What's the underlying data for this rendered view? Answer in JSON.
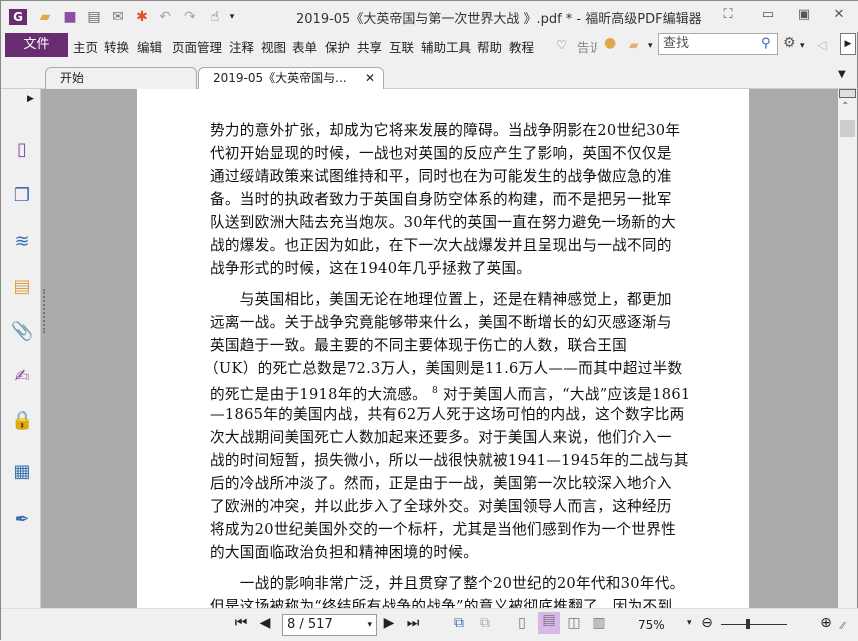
{
  "window": {
    "title": "2019-05《大英帝国与第一次世界大战 》.pdf * - 福昕高级PDF编辑器"
  },
  "menu": {
    "file": "文件",
    "items": [
      "主页",
      "转换",
      "编辑",
      "页面管理",
      "注释",
      "视图",
      "表单",
      "保护",
      "共享",
      "互联",
      "辅助工具",
      "帮助",
      "教程"
    ],
    "tell_me": "告诉",
    "search_placeholder": "查找"
  },
  "tabs": [
    {
      "label": "开始"
    },
    {
      "label": "2019-05《大英帝国与..."
    }
  ],
  "document": {
    "paragraphs": [
      [
        "势力的意外扩张，却成为它将来发展的障碍。当战争阴影在20世纪30年",
        "代初开始显现的时候，一战也对英国的反应产生了影响，英国不仅仅是",
        "通过绥靖政策来试图维持和平，同时也在为可能发生的战争做应急的准",
        "备。当时的执政者致力于英国自身防空体系的构建，而不是把另一批军",
        "队送到欧洲大陆去充当炮灰。30年代的英国一直在努力避免一场新的大",
        "战的爆发。也正因为如此，在下一次大战爆发并且呈现出与一战不同的",
        "战争形式的时候，这在1940年几乎拯救了英国。"
      ],
      [
        "　　与英国相比，美国无论在地理位置上，还是在精神感觉上，都更加",
        "远离一战。关于战争究竟能够带来什么，美国不断增长的幻灭感逐渐与",
        "英国趋于一致。最主要的不同主要体现于伤亡的人数，联合王国",
        "（UK）的死亡总数是72.3万人，美国则是11.6万人——而其中超过半数",
        "的死亡是由于1918年的大流感。",
        "对于美国人而言，“大战”应该是1861",
        "—1865年的美国内战，共有62万人死于这场可怕的内战，这个数字比两",
        "次大战期间美国死亡人数加起来还要多。对于美国人来说，他们介入一",
        "战的时间短暂，损失微小，所以一战很快就被1941—1945年的二战与其",
        "后的冷战所冲淡了。然而，正是由于一战，美国第一次比较深入地介入",
        "了欧洲的冲突，并以此步入了全球外交。对美国领导人而言，这种经历",
        "将成为20世纪美国外交的一个标杆，尤其是当他们感到作为一个世界性",
        "的大国面临政治负担和精神困境的时候。"
      ],
      [
        "　　一战的影响非常广泛，并且贯穿了整个20世纪的20年代和30年代。",
        "但是这场被称为“终结所有战争的战争”的意义被彻底推翻了，因为不到"
      ]
    ],
    "footnote_mark": "8"
  },
  "status": {
    "page": "8 / 517",
    "zoom": "75%"
  }
}
